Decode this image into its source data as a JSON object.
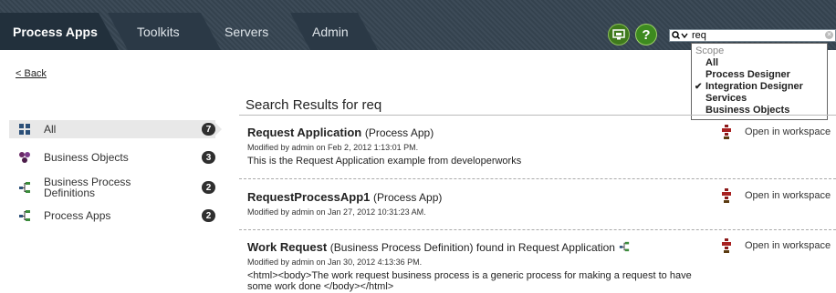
{
  "nav": {
    "tabs": [
      {
        "label": "Process Apps",
        "active": true
      },
      {
        "label": "Toolkits",
        "active": false
      },
      {
        "label": "Servers",
        "active": false
      },
      {
        "label": "Admin",
        "active": false
      }
    ],
    "help_label": "?",
    "search_value": "req",
    "scope_dropdown": {
      "title": "Scope",
      "options": [
        {
          "label": "All",
          "checked": false
        },
        {
          "label": "Process Designer",
          "checked": false
        },
        {
          "label": "Integration Designer",
          "checked": true
        },
        {
          "label": "Services",
          "checked": false
        },
        {
          "label": "Business Objects",
          "checked": false
        }
      ]
    }
  },
  "back_link": "< Back",
  "facets": [
    {
      "label": "All",
      "count": "7",
      "icon": "grid-icon",
      "selected": true
    },
    {
      "label": "Business Objects",
      "count": "3",
      "icon": "business-object-icon"
    },
    {
      "label": "Business Process\nDefinitions",
      "count": "2",
      "icon": "process-icon"
    },
    {
      "label": "Process Apps",
      "count": "2",
      "icon": "process-icon"
    }
  ],
  "results": {
    "heading": "Search Results for req",
    "open_label": "Open in workspace",
    "items": [
      {
        "title": "Request Application",
        "type": "(Process App)",
        "suffix": "",
        "meta": "Modified by admin on Feb 2, 2012 1:13:01 PM.",
        "desc": "This is the Request Application example from developerworks"
      },
      {
        "title": "RequestProcessApp1",
        "type": "(Process App)",
        "suffix": "",
        "meta": "Modified by admin on Jan 27, 2012 10:31:23 AM.",
        "desc": ""
      },
      {
        "title": "Work Request",
        "type": "(Business Process Definition) found in Request Application",
        "suffix": "process-icon",
        "meta": "Modified by admin on Jan 30, 2012 4:13:36 PM.",
        "desc": "<html><body>The work request business process is a generic process for making a request to have some work done </body></html>"
      }
    ]
  },
  "colors": {
    "nav_bg": "#3a4753",
    "accent_green": "#3d8a1f",
    "badge": "#2f2f2f"
  }
}
